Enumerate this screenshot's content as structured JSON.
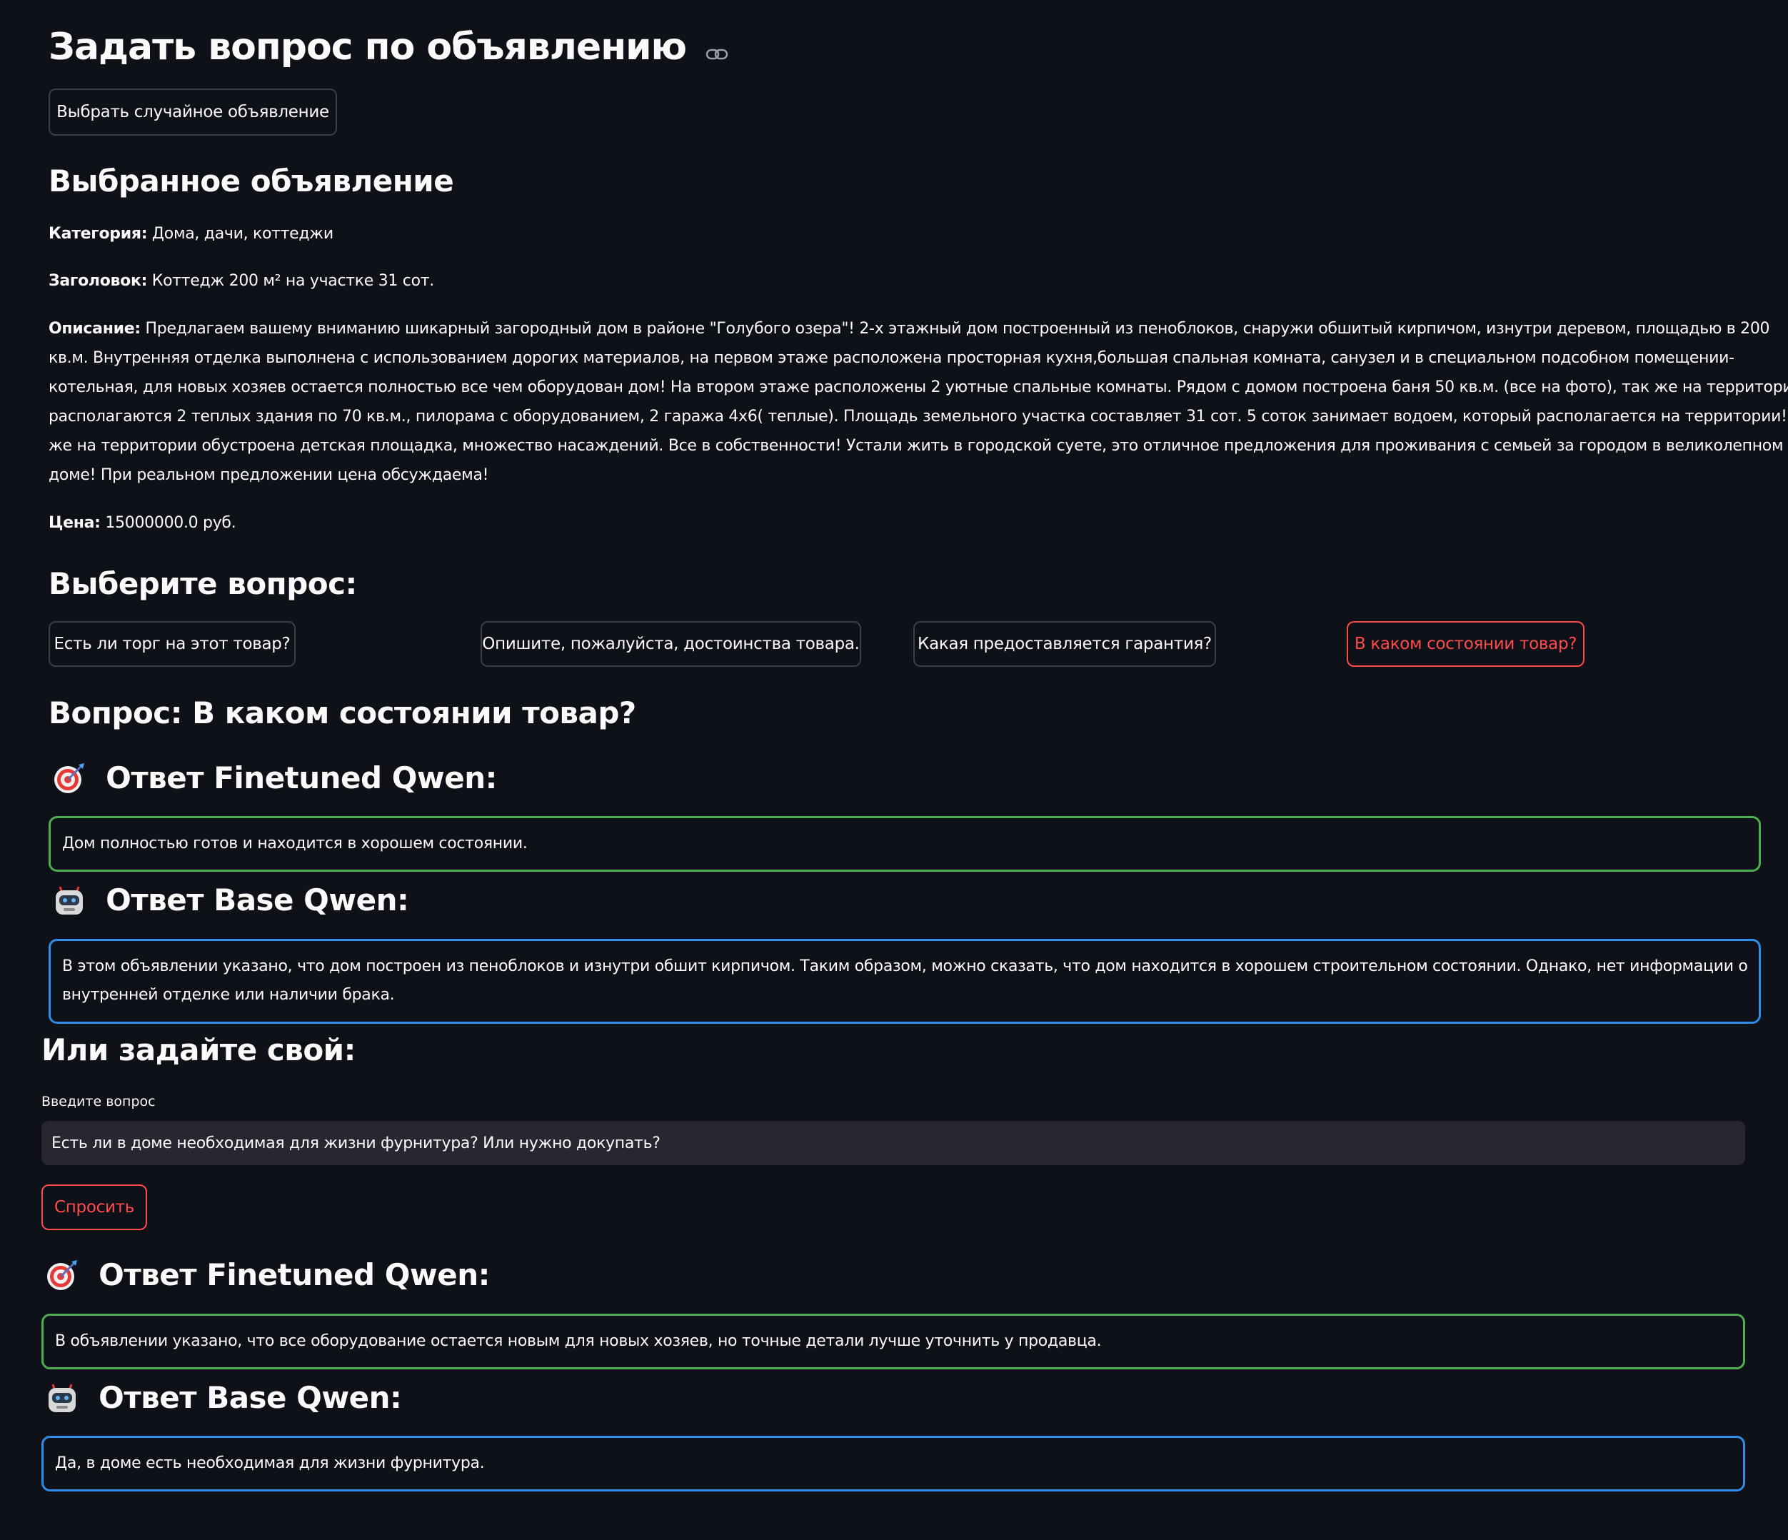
{
  "page": {
    "title": "Задать вопрос по объявлению",
    "random_button": "Выбрать случайное объявление"
  },
  "listing": {
    "heading": "Выбранное объявление",
    "category_label": "Категория:",
    "category_value": " Дома, дачи, коттеджи",
    "title_label": "Заголовок:",
    "title_value": " Коттедж 200 м² на участке 31 сот.",
    "description_label": "Описание:",
    "description_lines": [
      " Предлагаем вашему вниманию шикарный загородный дом в районе \"Голубого озера\"! 2-х этажный дом построенный из пеноблоков, снаружи обшитый кирпичом, изнутри деревом, площадью в 200",
      "кв.м. Внутренняя отделка выполнена с использованием дорогих материалов, на первом этаже расположена просторная кухня,большая спальная комната, санузел и в специальном подсобном помещении-",
      "котельная, для новых хозяев остается полностью все чем оборудован дом! На втором этаже расположены 2 уютные спальные комнаты. Рядом с домом построена баня 50 кв.м. (все на фото), так же на территории",
      "располагаются 2 теплых здания по 70 кв.м., пилорама с оборудованием, 2 гаража 4х6( теплые). Площадь земельного участка составляет 31 сот. 5 соток занимает водоем, который располагается на территории! Так",
      "же на территории обустроена детская площадка, множество насаждений. Все в собственности! Устали жить в городской суете, это отличное предложения для проживания с семьей за городом в великолепном",
      "доме! При реальном предложении цена обсуждаема!"
    ],
    "price_label": "Цена:",
    "price_value": " 15000000.0 руб."
  },
  "questions": {
    "heading": "Выберите вопрос:",
    "options": [
      "Есть ли торг на этот товар?",
      "Опишите, пожалуйста, достоинства товара.",
      "Какая предоставляется гарантия?",
      "В каком состоянии товар?"
    ],
    "selected_heading": "Вопрос: В каком состоянии товар?"
  },
  "answers_1": {
    "finetuned_heading": "Ответ Finetuned Qwen:",
    "finetuned_text": "Дом полностью готов и находится в хорошем состоянии.",
    "base_heading": "Ответ Base Qwen:",
    "base_lines": [
      "В этом объявлении указано, что дом построен из пеноблоков и изнутри обшит кирпичом. Таким образом, можно сказать, что дом находится в хорошем строительном состоянии. Однако, нет информации о",
      "внутренней отделке или наличии брака."
    ]
  },
  "custom": {
    "heading": "Или задайте свой:",
    "input_label": "Введите вопрос",
    "input_value": "Есть ли в доме необходимая для жизни фурнитура? Или нужно докупать?",
    "ask_button": "Спросить"
  },
  "answers_2": {
    "finetuned_heading": "Ответ Finetuned Qwen:",
    "finetuned_text": "В объявлении указано, что все оборудование остается новым для новых хозяев, но точные детали лучше уточнить у продавца.",
    "base_heading": "Ответ Base Qwen:",
    "base_text": "Да, в доме есть необходимая для жизни фурнитура."
  },
  "colors": {
    "background": "#0e1117",
    "text": "#fafafa",
    "accent_red": "#ff4b4b",
    "finetuned_border": "#4caf50",
    "base_border": "#2f8fe8",
    "input_bg": "#262730"
  },
  "icons": {
    "title_link": "link-icon",
    "finetuned": "target-dart-icon",
    "base": "robot-icon"
  }
}
